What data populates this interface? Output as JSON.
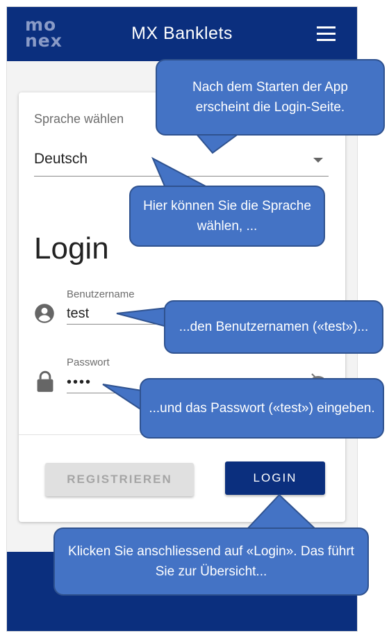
{
  "app": {
    "logo_line1": "mo",
    "logo_line2": "nex",
    "title": "MX Banklets"
  },
  "form": {
    "language_label": "Sprache wählen",
    "language_value": "Deutsch",
    "heading": "Login",
    "username_label": "Benutzername",
    "username_value": "test",
    "password_label": "Passwort",
    "password_value": "••••",
    "register_label": "REGISTRIEREN",
    "login_label": "LOGIN"
  },
  "callouts": {
    "c1": "Nach dem Starten der App erscheint die Login-Seite.",
    "c2": "Hier können Sie die Sprache wählen, ...",
    "c3": "...den Benutzernamen («test»)...",
    "c4": "...und das Passwort («test») eingeben.",
    "c5": "Klicken Sie anschliessend auf «Login». Das führt Sie zur Übersicht..."
  },
  "colors": {
    "appbar": "#0b2f7e",
    "callout_fill": "#4473c5",
    "callout_border": "#2f528f"
  },
  "icons": [
    "menu-icon",
    "account-circle-icon",
    "lock-icon",
    "visibility-off-icon",
    "dropdown-caret-icon"
  ]
}
